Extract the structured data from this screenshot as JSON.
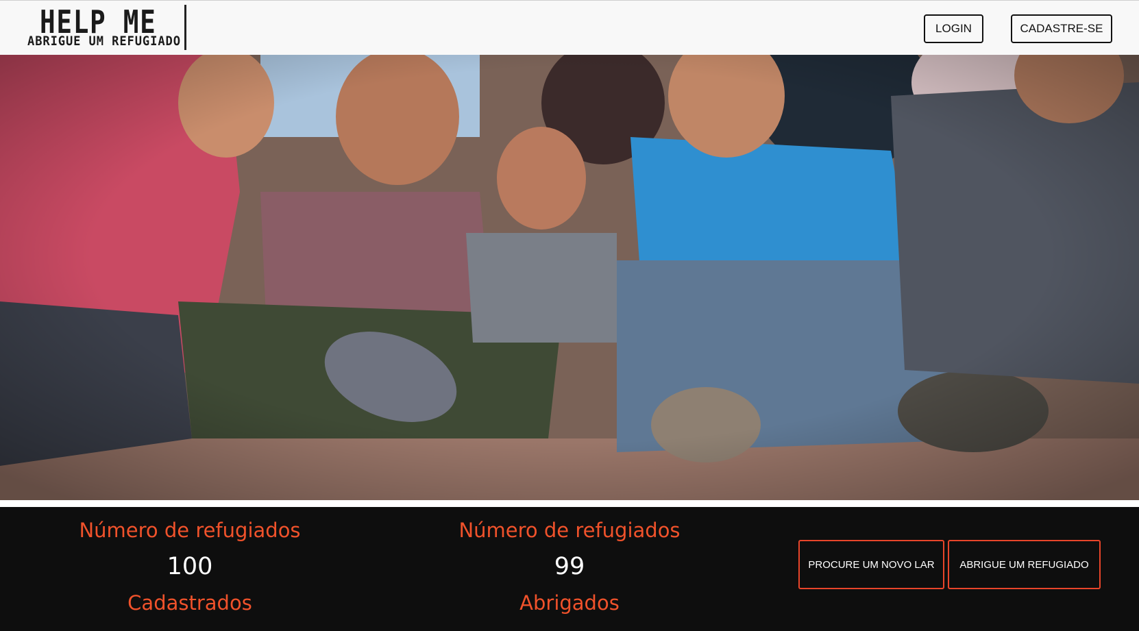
{
  "header": {
    "logo_title": "HELP ME",
    "logo_subtitle": "ABRIGUE UM REFUGIADO",
    "login_label": "LOGIN",
    "signup_label": "CADASTRE-SE"
  },
  "stats": [
    {
      "label": "Número de refugiados",
      "value": "100",
      "caption": "Cadastrados"
    },
    {
      "label": "Número de refugiados",
      "value": "99",
      "caption": "Abrigados"
    }
  ],
  "actions": {
    "find_home_label": "PROCURE UM NOVO LAR",
    "shelter_label": "ABRIGUE UM REFUGIADO"
  },
  "colors": {
    "accent": "#f0522b",
    "footer_bg": "#0e0e0e",
    "header_bg": "#f8f8f8"
  }
}
